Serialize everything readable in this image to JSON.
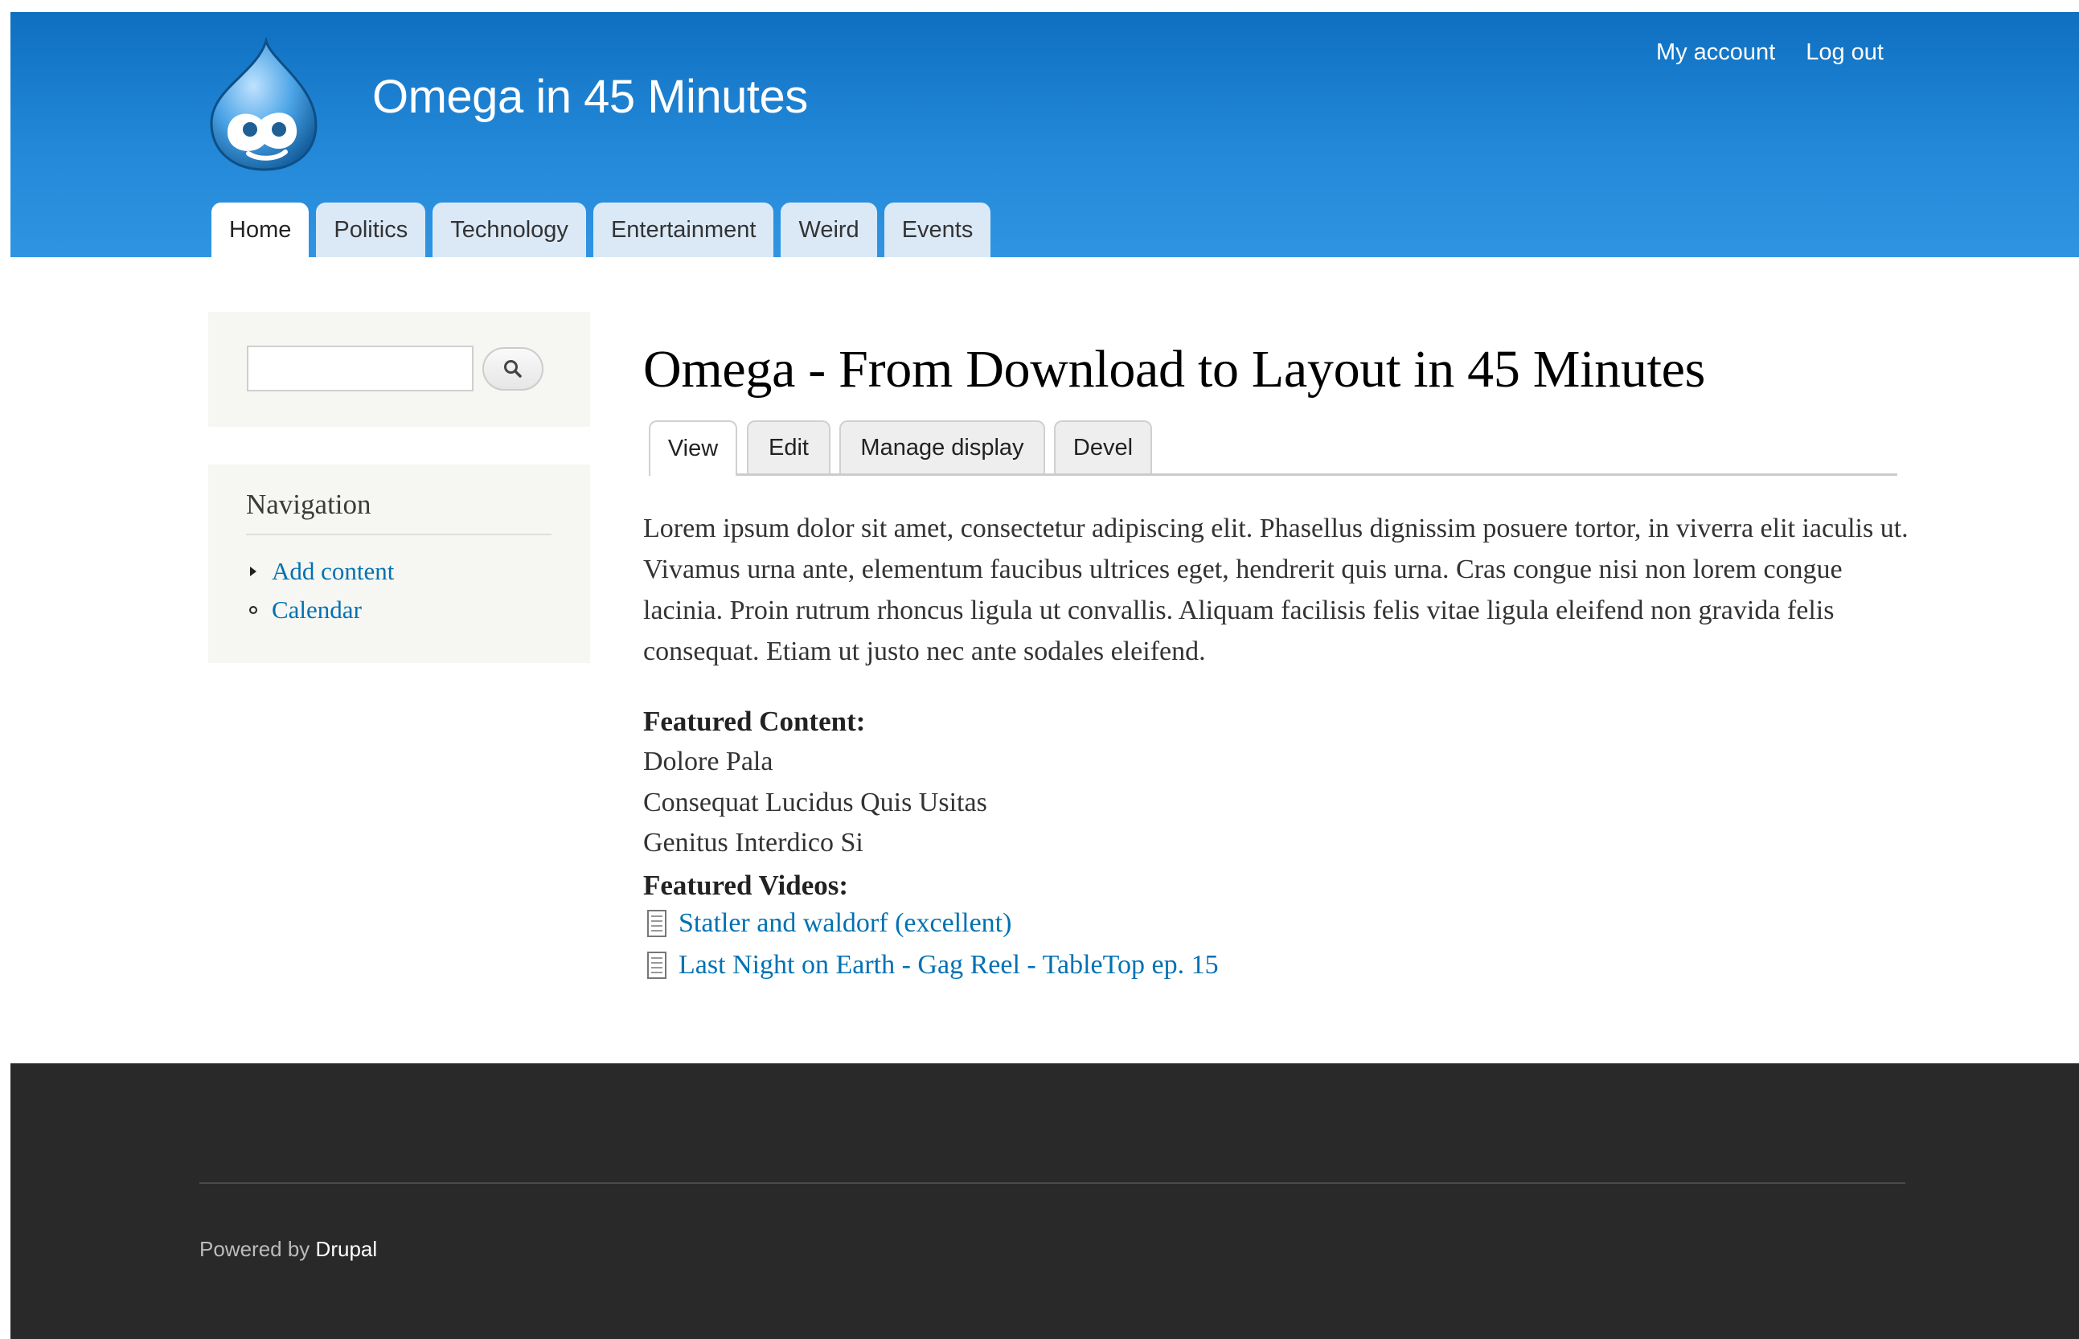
{
  "header": {
    "site_name": "Omega in 45 Minutes",
    "secondary_menu": [
      {
        "label": "My account"
      },
      {
        "label": "Log out"
      }
    ],
    "main_menu": [
      {
        "label": "Home",
        "active": true
      },
      {
        "label": "Politics"
      },
      {
        "label": "Technology"
      },
      {
        "label": "Entertainment"
      },
      {
        "label": "Weird"
      },
      {
        "label": "Events"
      }
    ]
  },
  "sidebar": {
    "search": {
      "value": "",
      "button_icon": "search-icon"
    },
    "navigation": {
      "title": "Navigation",
      "items": [
        {
          "label": "Add content",
          "bullet": "triangle-right"
        },
        {
          "label": "Calendar",
          "bullet": "circle"
        }
      ]
    }
  },
  "main": {
    "title": "Omega - From Download to Layout in 45 Minutes",
    "tabs": [
      {
        "label": "View",
        "active": true
      },
      {
        "label": "Edit"
      },
      {
        "label": "Manage display"
      },
      {
        "label": "Devel"
      }
    ],
    "body": "Lorem ipsum dolor sit amet, consectetur adipiscing elit. Phasellus dignissim posuere tortor, in viverra elit iaculis ut. Vivamus urna ante, elementum faucibus ultrices eget, hendrerit quis urna. Cras congue nisi non lorem congue lacinia. Proin rutrum rhoncus ligula ut convallis. Aliquam facilisis felis vitae ligula eleifend non gravida felis consequat. Etiam ut justo nec ante sodales eleifend.",
    "featured_content": {
      "label": "Featured Content:",
      "items": [
        "Dolore Pala",
        "Consequat Lucidus Quis Usitas",
        "Genitus Interdico Si"
      ]
    },
    "featured_videos": {
      "label": "Featured Videos:",
      "items": [
        "Statler and waldorf (excellent)",
        "Last Night on Earth - Gag Reel - TableTop ep. 15"
      ]
    }
  },
  "footer": {
    "powered_by": "Powered by",
    "drupal": "Drupal"
  },
  "colors": {
    "header_blue": "#1f83d3",
    "link_blue": "#0071b3",
    "footer_dark": "#292929",
    "sidebar_bg": "#f6f6f2"
  }
}
